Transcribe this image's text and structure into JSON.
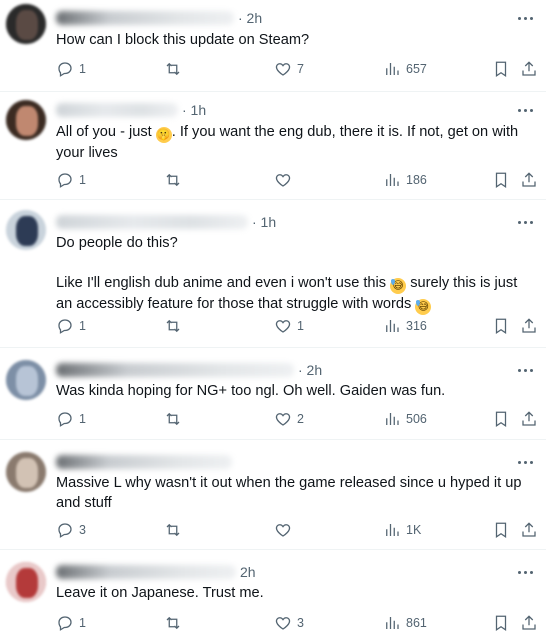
{
  "replies": [
    {
      "time": "· 2h",
      "text": "How can I block this update on Steam?",
      "reply_count": "1",
      "retweet_count": "",
      "like_count": "7",
      "view_count": "657",
      "avatar_colors": [
        "#2a2a2a",
        "#5a4a44"
      ]
    },
    {
      "time": "· 1h",
      "text_before": "All of you - just ",
      "text_after": ". If you want the eng dub, there it is. If not, get on with your lives",
      "reply_count": "1",
      "retweet_count": "",
      "like_count": "",
      "view_count": "186",
      "avatar_colors": [
        "#3b2b22",
        "#c08870"
      ]
    },
    {
      "time": "· 1h",
      "text_line1": "Do people do this?",
      "text_line2a": "Like I'll english dub anime and even i won't use this ",
      "text_line2b": " surely this is just an accessibly feature for those that struggle with words ",
      "reply_count": "1",
      "retweet_count": "",
      "like_count": "1",
      "view_count": "316",
      "avatar_colors": [
        "#c9d3dc",
        "#2d3b55"
      ]
    },
    {
      "time": "· 2h",
      "text": "Was kinda hoping for NG+ too ngl. Oh well. Gaiden was fun.",
      "reply_count": "1",
      "retweet_count": "",
      "like_count": "2",
      "view_count": "506",
      "avatar_colors": [
        "#7d8fa6",
        "#b7c4d6"
      ]
    },
    {
      "time": "",
      "text": "Massive L why wasn't it out when the game released since u hyped it up and stuff",
      "reply_count": "3",
      "retweet_count": "",
      "like_count": "",
      "view_count": "1K",
      "avatar_colors": [
        "#8a7a6e",
        "#d2c2b4"
      ]
    },
    {
      "time": "2h",
      "text": "Leave it on Japanese. Trust me.",
      "reply_count": "1",
      "retweet_count": "",
      "like_count": "3",
      "view_count": "861",
      "avatar_colors": [
        "#b43a3a",
        "#e9c9c9"
      ]
    }
  ],
  "emojis": {
    "shush": "🤫",
    "sweat": "😅"
  },
  "icons": {
    "reply": "reply-icon",
    "retweet": "retweet-icon",
    "like": "heart-icon",
    "views": "views-icon",
    "bookmark": "bookmark-icon",
    "share": "share-icon",
    "more": "more-icon"
  }
}
